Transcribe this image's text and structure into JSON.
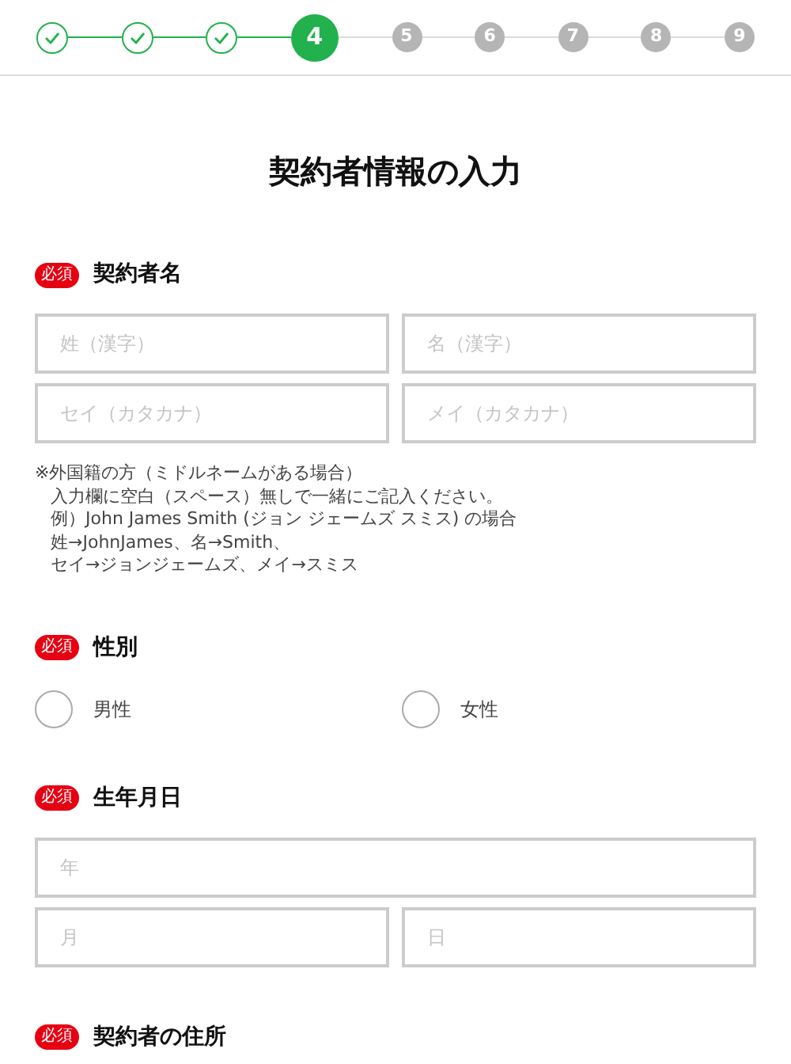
{
  "stepper": [
    {
      "done": true,
      "current": false
    },
    {
      "done": true,
      "current": false
    },
    {
      "done": true,
      "current": false
    },
    {
      "label": "4",
      "done": false,
      "current": true
    },
    {
      "label": "5",
      "done": false,
      "current": false
    },
    {
      "label": "6",
      "done": false,
      "current": false
    },
    {
      "label": "7",
      "done": false,
      "current": false
    },
    {
      "label": "8",
      "done": false,
      "current": false
    },
    {
      "label": "9",
      "done": false,
      "current": false
    }
  ],
  "title": "契約者情報の入力",
  "sections": [
    {
      "kind": "fields",
      "badge": "必須",
      "heading": "契約者名",
      "fields": [
        {
          "placeholder": "姓（漢字）",
          "kind": "half"
        },
        {
          "placeholder": "名（漢字）",
          "kind": "half"
        },
        {
          "placeholder": "セイ（カタカナ）",
          "kind": "half"
        },
        {
          "placeholder": "メイ（カタカナ）",
          "kind": "half"
        }
      ],
      "note": [
        "※外国籍の方（ミドルネームがある場合）",
        "入力欄に空白（スペース）無しで一緒にご記入ください。",
        "例）John James Smith (ジョン ジェームズ スミス) の場合",
        "姓→JohnJames、名→Smith、",
        "セイ→ジョンジェームズ、メイ→スミス"
      ]
    },
    {
      "kind": "radio",
      "badge": "必須",
      "heading": "性別",
      "options": [
        {
          "label": "男性",
          "selected": false
        },
        {
          "label": "女性",
          "selected": false
        }
      ]
    },
    {
      "kind": "fields",
      "badge": "必須",
      "heading": "生年月日",
      "fields": [
        {
          "placeholder": "年",
          "kind": "full"
        },
        {
          "placeholder": "月",
          "kind": "half"
        },
        {
          "placeholder": "日",
          "kind": "half"
        }
      ]
    },
    {
      "kind": "heading",
      "badge": "必須",
      "heading": "契約者の住所"
    }
  ]
}
